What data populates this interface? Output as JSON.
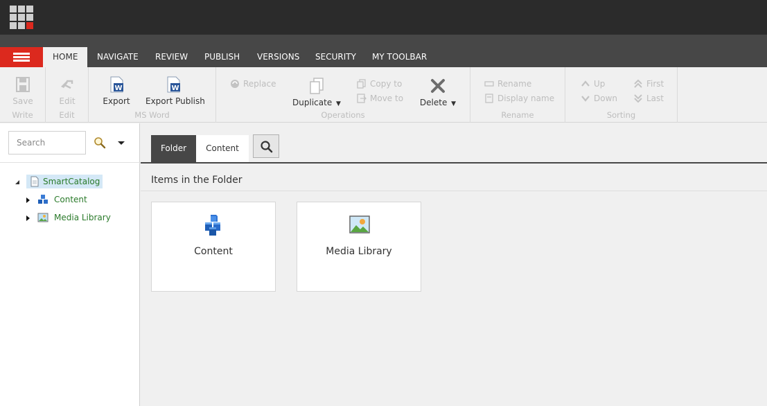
{
  "colors": {
    "brand_red": "#dc291e",
    "dark_bar": "#2b2b2b",
    "tab_bar": "#474747",
    "tree_text": "#2a7a2a",
    "selected_bg": "#d4e8f6"
  },
  "tabs": [
    {
      "label": "HOME",
      "active": true
    },
    {
      "label": "NAVIGATE"
    },
    {
      "label": "REVIEW"
    },
    {
      "label": "PUBLISH"
    },
    {
      "label": "VERSIONS"
    },
    {
      "label": "SECURITY"
    },
    {
      "label": "MY TOOLBAR"
    }
  ],
  "ribbon": {
    "write": {
      "label": "Write",
      "save": "Save"
    },
    "edit": {
      "label": "Edit",
      "edit": "Edit"
    },
    "msword": {
      "label": "MS Word",
      "export": "Export",
      "export_publish": "Export Publish"
    },
    "operations": {
      "label": "Operations",
      "replace": "Replace",
      "duplicate": "Duplicate",
      "copy_to": "Copy to",
      "move_to": "Move to",
      "delete": "Delete"
    },
    "rename": {
      "label": "Rename",
      "rename": "Rename",
      "display_name": "Display name"
    },
    "sorting": {
      "label": "Sorting",
      "up": "Up",
      "down": "Down",
      "first": "First",
      "last": "Last"
    }
  },
  "sidebar": {
    "search_placeholder": "Search",
    "tree": [
      {
        "label": "SmartCatalog",
        "icon": "page-icon",
        "selected": true
      },
      {
        "label": "Content",
        "icon": "cubes-icon"
      },
      {
        "label": "Media Library",
        "icon": "image-icon"
      }
    ]
  },
  "main": {
    "tabs": [
      {
        "label": "Folder",
        "active": true
      },
      {
        "label": "Content"
      }
    ],
    "section_title": "Items in the Folder",
    "cards": [
      {
        "title": "Content",
        "icon": "cubes-icon"
      },
      {
        "title": "Media Library",
        "icon": "image-icon"
      }
    ]
  }
}
